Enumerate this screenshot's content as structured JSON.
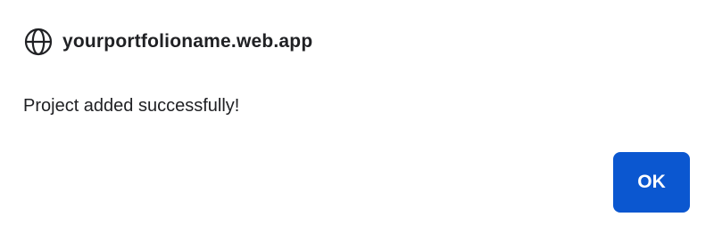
{
  "dialog": {
    "origin": "yourportfolioname.web.app",
    "origin_icon": "globe-icon",
    "message": "Project added successfully!",
    "ok_label": "OK"
  },
  "colors": {
    "button_background": "#0b57d0",
    "button_text": "#ffffff",
    "text": "#202124",
    "background": "#ffffff"
  }
}
